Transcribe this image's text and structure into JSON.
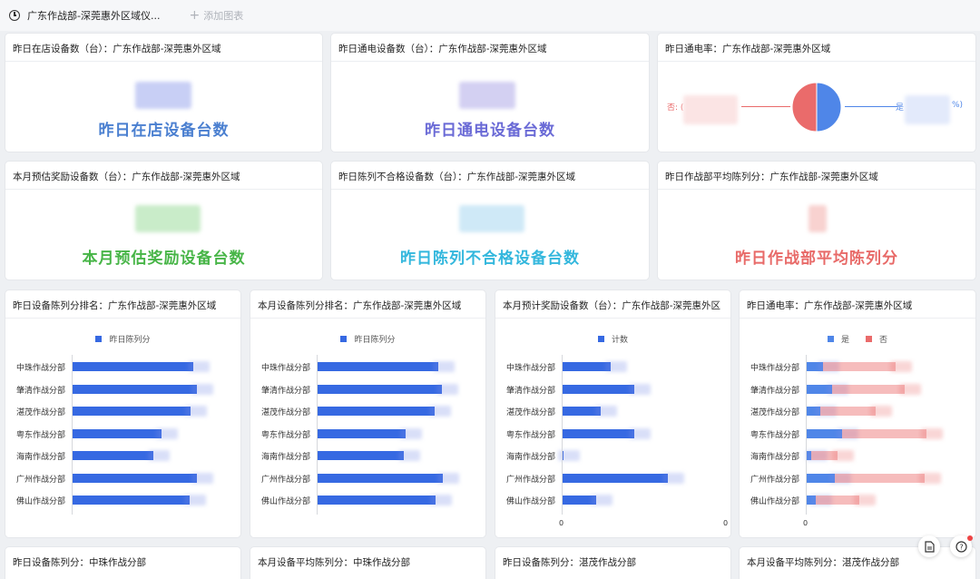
{
  "topbar": {
    "tab_label": "广东作战部-深莞惠外区域仪...",
    "add_chart_label": "添加图表"
  },
  "kpi_cards": [
    {
      "title": "昨日在店设备数（台）：广东作战部-深莞惠外区域",
      "metric": "昨日在店设备台数",
      "color": "#4a7fd0",
      "blur_color": "#c8cff5"
    },
    {
      "title": "昨日通电设备数（台）：广东作战部-深莞惠外区域",
      "metric": "昨日通电设备台数",
      "color": "#6a6ad6",
      "blur_color": "#d3d0f2"
    },
    {
      "title": "本月预估奖励设备数（台）：广东作战部-深莞惠外区域",
      "metric": "本月预估奖励设备台数",
      "color": "#47b547",
      "blur_color": "#c9ecc9"
    },
    {
      "title": "昨日陈列不合格设备数（台）：广东作战部-深莞惠外区域",
      "metric": "昨日陈列不合格设备台数",
      "color": "#33b7dd",
      "blur_color": "#cfe9f7"
    },
    {
      "title": "昨日作战部平均陈列分：广东作战部-深莞惠外区域",
      "metric": "昨日作战部平均陈列分",
      "color": "#e86a68",
      "blur_color": "#f8d2d0"
    }
  ],
  "pie_card": {
    "title": "昨日通电率：广东作战部-深莞惠外区域",
    "label_no": "否: (",
    "label_yes": "是",
    "label_yes_tail": "%)",
    "colors": {
      "yes": "#4f86e8",
      "no": "#ea6b6b"
    },
    "chart_data": {
      "type": "pie",
      "labels": [
        "是",
        "否"
      ],
      "values": [
        50,
        50
      ]
    }
  },
  "bar_cards": [
    {
      "title": "昨日设备陈列分排名：广东作战部-深莞惠外区域",
      "chart_data": {
        "type": "bar",
        "orientation": "horizontal",
        "categories": [
          "中珠作战分部",
          "肇清作战分部",
          "湛茂作战分部",
          "粤东作战分部",
          "海南作战分部",
          "广州作战分部",
          "佛山作战分部"
        ],
        "series": [
          {
            "name": "昨日陈列分",
            "values": [
              84,
              86,
              82,
              62,
              56,
              86,
              81
            ],
            "color": "#3669e2"
          }
        ],
        "xlim": [
          0,
          100
        ]
      }
    },
    {
      "title": "本月设备陈列分排名：广东作战部-深莞惠外区域",
      "chart_data": {
        "type": "bar",
        "orientation": "horizontal",
        "categories": [
          "中珠作战分部",
          "肇清作战分部",
          "湛茂作战分部",
          "粤东作战分部",
          "海南作战分部",
          "广州作战分部",
          "佛山作战分部"
        ],
        "series": [
          {
            "name": "昨日陈列分",
            "values": [
              84,
              86,
              81,
              61,
              60,
              87,
              82
            ],
            "color": "#3669e2"
          }
        ],
        "xlim": [
          0,
          100
        ]
      }
    },
    {
      "title": "本月预计奖励设备数（台）：广东作战部-深莞惠外区",
      "chart_data": {
        "type": "bar",
        "orientation": "horizontal",
        "categories": [
          "中珠作战分部",
          "肇清作战分部",
          "湛茂作战分部",
          "粤东作战分部",
          "海南作战分部",
          "广州作战分部",
          "佛山作战分部"
        ],
        "series": [
          {
            "name": "计数",
            "values": [
              34,
              50,
              27,
              50,
              1,
              73,
              24
            ],
            "color": "#3669e2"
          }
        ],
        "xlim": [
          0,
          100
        ],
        "xticks": [
          "0",
          "0"
        ]
      }
    },
    {
      "title": "昨日通电率：广东作战部-深莞惠外区域",
      "chart_data": {
        "type": "bar",
        "orientation": "horizontal",
        "stacked": true,
        "categories": [
          "中珠作战分部",
          "肇清作战分部",
          "湛茂作战分部",
          "粤东作战分部",
          "海南作战分部",
          "广州作战分部",
          "佛山作战分部"
        ],
        "series": [
          {
            "name": "是",
            "values": [
              12,
              18,
              10,
              25,
              4,
              20,
              7
            ],
            "color": "#4f86e8"
          },
          {
            "name": "否",
            "values": [
              50,
              50,
              38,
              58,
              18,
              62,
              30
            ],
            "color": "#ea6b6b"
          }
        ],
        "xlim": [
          0,
          100
        ],
        "xticks": [
          "0"
        ]
      }
    }
  ],
  "bottom_cards": [
    {
      "title": "昨日设备陈列分：中珠作战分部"
    },
    {
      "title": "本月设备平均陈列分：中珠作战分部"
    },
    {
      "title": "昨日设备陈列分：湛茂作战分部"
    },
    {
      "title": "本月设备平均陈列分：湛茂作战分部"
    }
  ],
  "floating": {
    "doc_icon": "document-icon",
    "help_icon": "help-icon"
  }
}
